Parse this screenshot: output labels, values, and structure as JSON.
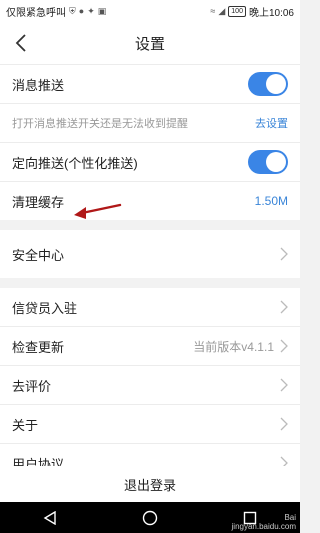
{
  "status_bar": {
    "left_text": "仅限紧急呼叫",
    "battery": "100",
    "time": "晚上10:06"
  },
  "header": {
    "title": "设置"
  },
  "settings": {
    "push": {
      "label": "消息推送",
      "enabled": true
    },
    "push_hint": {
      "text": "打开消息推送开关还是无法收到提醒",
      "link": "去设置"
    },
    "targeted_push": {
      "label": "定向推送(个性化推送)",
      "enabled": true
    },
    "clear_cache": {
      "label": "清理缓存",
      "value": "1.50M"
    },
    "security_center": {
      "label": "安全中心"
    },
    "loan_officer": {
      "label": "信贷员入驻"
    },
    "check_update": {
      "label": "检查更新",
      "value": "当前版本v4.1.1"
    },
    "rate": {
      "label": "去评价"
    },
    "about": {
      "label": "关于"
    },
    "user_agreement": {
      "label": "用户协议"
    }
  },
  "logout": {
    "label": "退出登录"
  },
  "watermark": {
    "line1": "Bai",
    "line2": "jingyan.baidu.com"
  },
  "colors": {
    "accent": "#3a85e6",
    "annotation": "#b01818"
  }
}
